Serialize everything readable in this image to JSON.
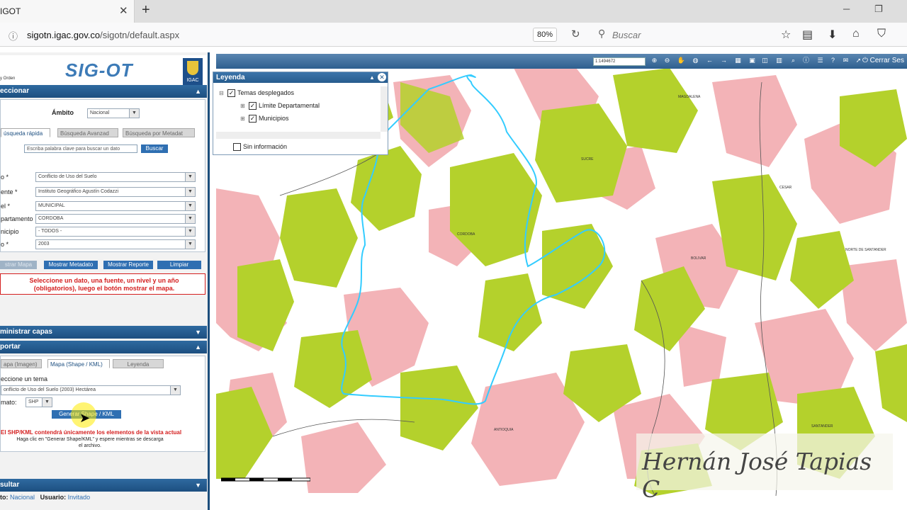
{
  "browser": {
    "tab_title": "IGOT",
    "url_domain": "sigotn.igac.gov.co",
    "url_path": "/sigotn/default.aspx",
    "zoom": "80%",
    "search_placeholder": "Buscar"
  },
  "app": {
    "logo": "SIG-OT",
    "igac_label": "IGAC",
    "logo_caption": "y Orden"
  },
  "panel": {
    "seleccionar_header": "eccionar",
    "ambito_label": "Ámbito",
    "ambito_value": "Nacional",
    "tabs": [
      "úsqueda rápida",
      "Búsqueda Avanzad",
      "Búsqueda por Metadat"
    ],
    "search_placeholder": "Escriba palabra clave para buscar un dato",
    "search_button": "Buscar",
    "fields": [
      {
        "label": "o *",
        "value": "Conflicto de Uso del Suelo"
      },
      {
        "label": "ente *",
        "value": "Instituto Geográfico Agustín Codazzi"
      },
      {
        "label": "el *",
        "value": "MUNICIPAL"
      },
      {
        "label": "partamento",
        "value": "CORDOBA"
      },
      {
        "label": "nicipio",
        "value": "- TODOS -"
      },
      {
        "label": "o *",
        "value": "2003"
      }
    ],
    "buttons": {
      "mostrar_mapa": "strar Mapa",
      "mostrar_metadato": "Mostrar Metadato",
      "mostrar_reporte": "Mostrar Reporte",
      "limpiar": "Limpiar"
    },
    "warning_line1": "Seleccione un dato, una fuente, un nivel y un año",
    "warning_line2": "(obligatorios), luego el botón mostrar el mapa.",
    "administrar_header": "ministrar capas",
    "exportar_header": "portar",
    "export_tabs": [
      "apa (Imagen)",
      "Mapa (Shape / KML)",
      "Leyenda"
    ],
    "tema_label": "eccione un tema",
    "tema_value": "onflicto de Uso del Suelo (2003) Hectárea",
    "formato_label": "mato:",
    "formato_value": "SHP",
    "generar_button": "Generar Shape / KML",
    "export_note_red": "El SHP/KML contendrá únicamente los elementos de la vista actual",
    "export_note_line1": "Haga clic en \"Generar Shape/KML\" y espere mientras se descarga",
    "export_note_line2": "el archivo.",
    "consultar_header": "sultar",
    "status_ambito_label": "to:",
    "status_ambito_value": "Nacional",
    "status_usuario_label": "Usuario:",
    "status_usuario_value": "Invitado"
  },
  "map": {
    "scale_value": "1:1494672",
    "cerrar_label": "Cerrar Ses",
    "legend": {
      "title": "Leyenda",
      "items": [
        "Temas desplegados",
        "Límite Departamental",
        "Municipios"
      ],
      "sin_info": "Sin información"
    },
    "labels": [
      "CORDOBA",
      "SUCRE",
      "BOLIVAR",
      "CESAR",
      "NORTE DE SANTANDER",
      "ANTIOQUIA",
      "SANTANDER",
      "MAGDALENA"
    ],
    "signature": "Hernán José Tapias C",
    "colors": {
      "vegetation": "#b4d12c",
      "conflict": "#f3b3b7",
      "boundary": "#33ccff"
    }
  }
}
